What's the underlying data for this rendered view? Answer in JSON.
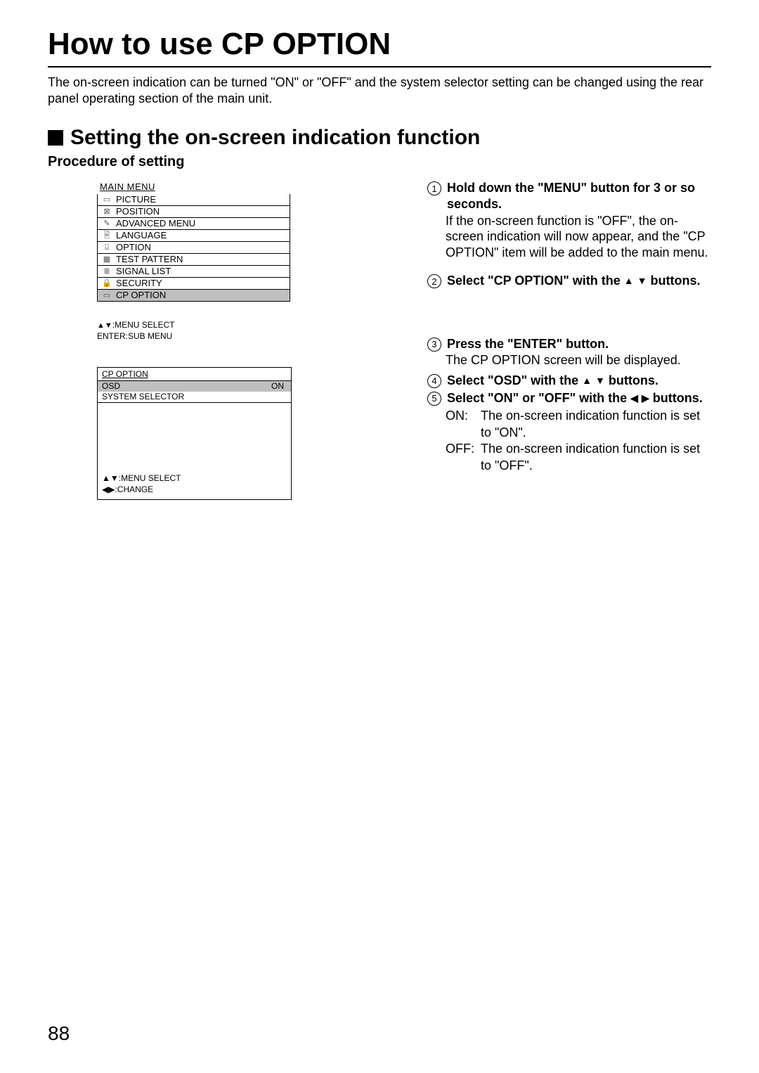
{
  "page": {
    "title": "How to use CP OPTION",
    "intro": "The on-screen indication can be turned \"ON\" or \"OFF\" and the system selector setting can be changed using the rear panel operating section of the main unit.",
    "number": "88"
  },
  "section": {
    "title": "Setting the on-screen indication function",
    "procedure_label": "Procedure of setting"
  },
  "main_menu": {
    "title": "MAIN MENU",
    "items": [
      {
        "icon": "▭",
        "label": "PICTURE"
      },
      {
        "icon": "⊠",
        "label": "POSITION"
      },
      {
        "icon": "✎",
        "label": "ADVANCED MENU"
      },
      {
        "icon": "🖹",
        "label": "LANGUAGE"
      },
      {
        "icon": "⌸",
        "label": "OPTION"
      },
      {
        "icon": "▦",
        "label": "TEST PATTERN"
      },
      {
        "icon": "≣",
        "label": "SIGNAL LIST"
      },
      {
        "icon": "🔒",
        "label": "SECURITY"
      },
      {
        "icon": "▭",
        "label": "CP OPTION",
        "highlight": true
      }
    ],
    "hint1": ":MENU SELECT",
    "hint2": "ENTER:SUB MENU"
  },
  "cp_menu": {
    "title": "CP OPTION",
    "rows": [
      {
        "label": "OSD",
        "value": "ON",
        "highlight": true
      },
      {
        "label": "SYSTEM SELECTOR",
        "value": ""
      }
    ],
    "hint1": ":MENU SELECT",
    "hint2": ":CHANGE"
  },
  "steps": {
    "s1": {
      "title": "Hold down the \"MENU\" button for 3 or so seconds.",
      "body": "If the on-screen function is \"OFF\", the on-screen indication will now appear, and the \"CP OPTION\" item will be added to the main menu."
    },
    "s2": {
      "title_before": "Select \"CP OPTION\" with the ",
      "title_after": " buttons."
    },
    "s3": {
      "title": "Press the \"ENTER\" button.",
      "body": "The CP OPTION screen will be displayed."
    },
    "s4": {
      "title_before": "Select \"OSD\" with the ",
      "title_after": "  buttons."
    },
    "s5": {
      "title_before": "Select \"ON\" or \"OFF\" with the ",
      "title_after": " buttons."
    },
    "on_label": "ON:",
    "on_text": "The on-screen indication function is set to \"ON\".",
    "off_label": "OFF:",
    "off_text": "The on-screen indication function is set to \"OFF\"."
  },
  "glyphs": {
    "up": "▲",
    "down": "▼",
    "left": "◀",
    "right": "▶"
  }
}
